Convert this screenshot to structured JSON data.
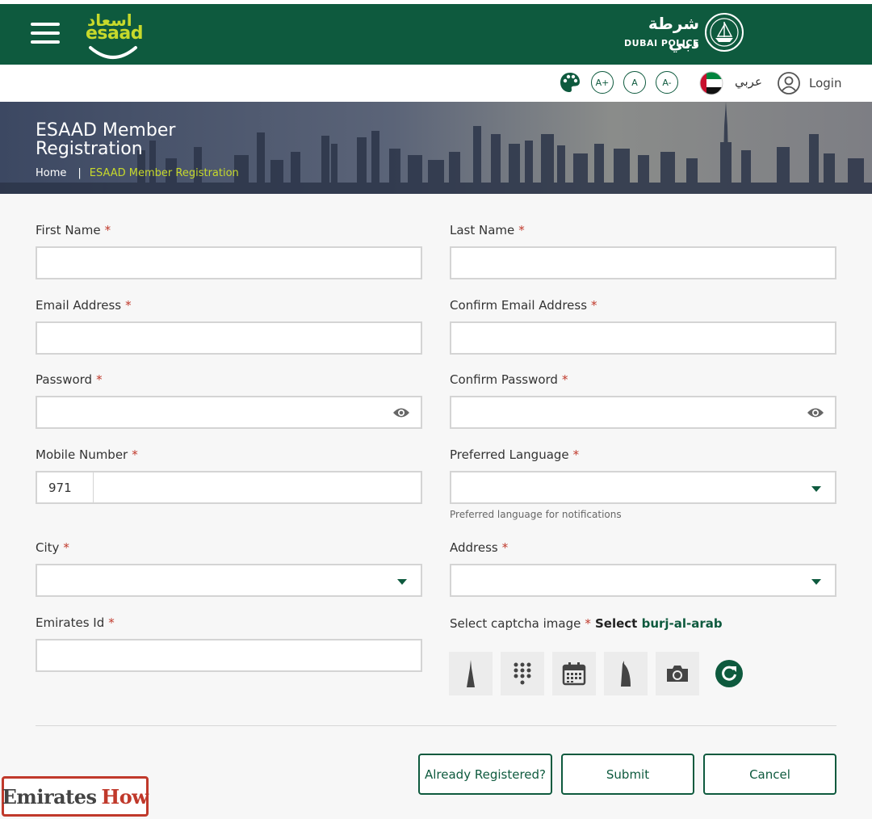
{
  "header": {
    "esaad_logo_ar": "اسعاد",
    "esaad_logo_en": "esaad",
    "police_logo_ar": "شرطة دبي",
    "police_logo_en": "DUBAI POLICE"
  },
  "utility_bar": {
    "font_increase": "A+",
    "font_reset": "A",
    "font_decrease": "A-",
    "language_link": "عربي",
    "login_label": "Login"
  },
  "banner": {
    "title": "ESAAD Member Registration",
    "breadcrumb": {
      "home": "Home",
      "separator": "|",
      "current": "ESAAD Member Registration"
    }
  },
  "form": {
    "first_name": {
      "label": "First Name",
      "value": ""
    },
    "last_name": {
      "label": "Last Name",
      "value": ""
    },
    "email": {
      "label": "Email Address",
      "value": ""
    },
    "confirm_email": {
      "label": "Confirm Email Address",
      "value": ""
    },
    "password": {
      "label": "Password",
      "value": ""
    },
    "confirm_password": {
      "label": "Confirm Password",
      "value": ""
    },
    "mobile": {
      "label": "Mobile Number",
      "prefix": "971",
      "value": ""
    },
    "preferred_language": {
      "label": "Preferred Language",
      "value": "",
      "hint": "Preferred language for notifications"
    },
    "city": {
      "label": "City",
      "value": ""
    },
    "address": {
      "label": "Address",
      "value": ""
    },
    "emirates_id": {
      "label": "Emirates Id",
      "value": ""
    },
    "required_mark": "*"
  },
  "captcha": {
    "label": "Select captcha image",
    "select_word": "Select",
    "target": "burj-al-arab",
    "tiles": [
      "burj-khalifa-icon",
      "dial-pad-icon",
      "calendar-icon",
      "burj-al-arab-icon",
      "camera-icon"
    ]
  },
  "buttons": {
    "already_registered": "Already Registered?",
    "submit": "Submit",
    "cancel": "Cancel"
  },
  "watermark": {
    "part1": "Emirates",
    "part2": "How"
  },
  "colors": {
    "brand_green": "#0e5a3e",
    "accent_lime": "#c7d92b",
    "required_red": "#c0392b"
  }
}
